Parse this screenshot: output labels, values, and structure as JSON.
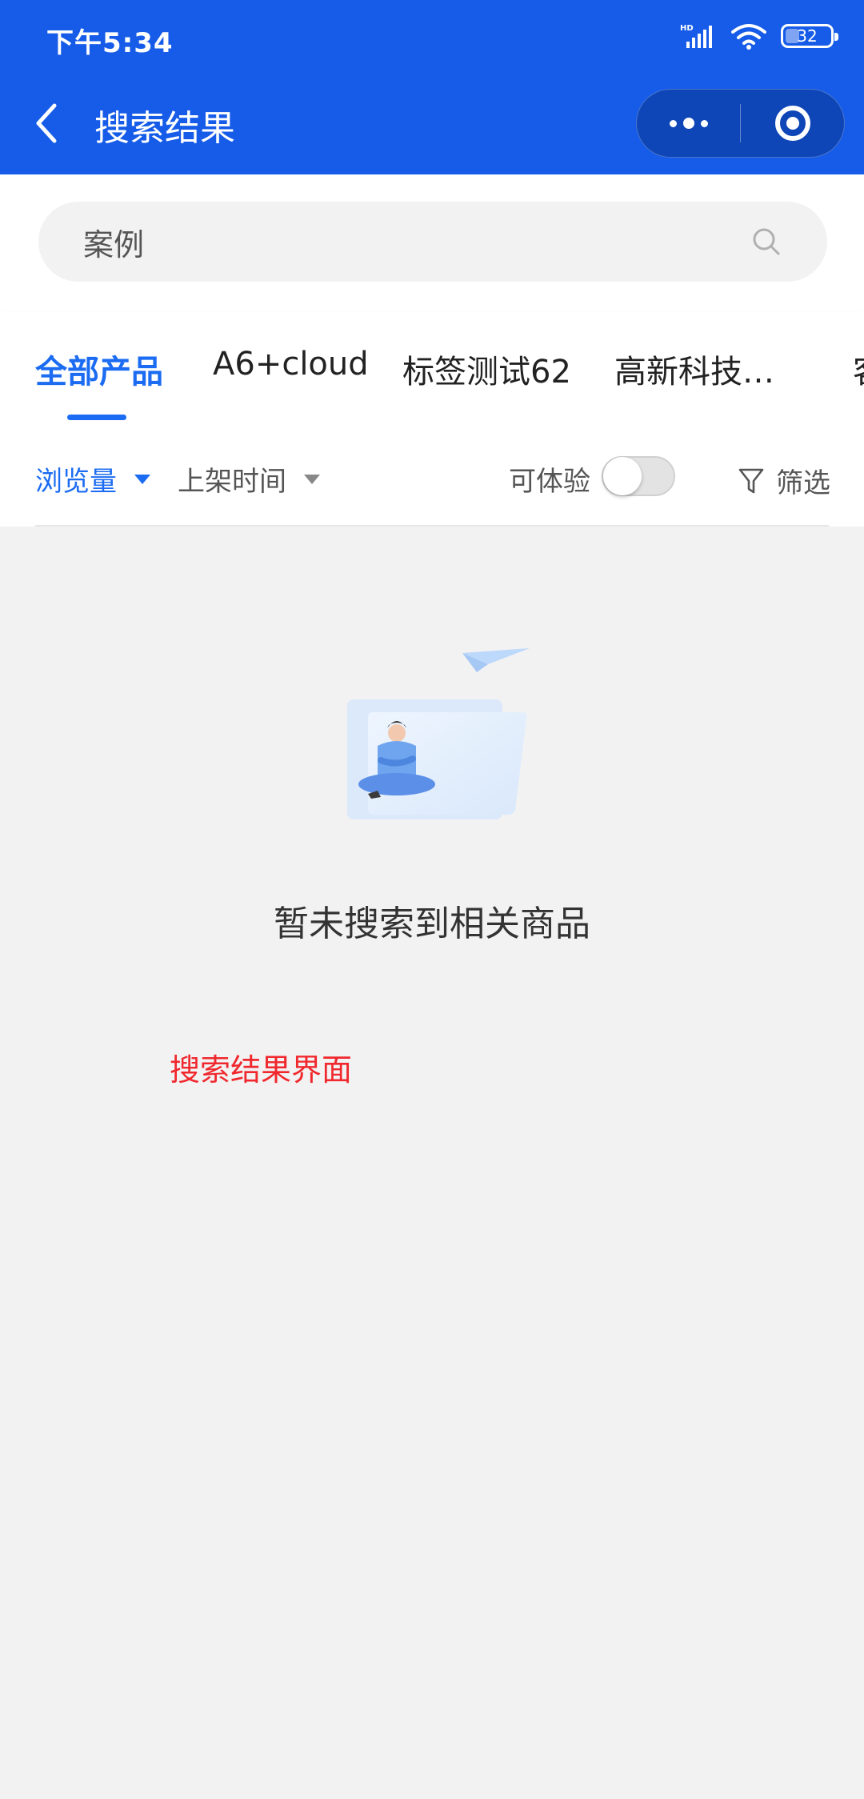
{
  "status_bar": {
    "time": "下午5:34",
    "network": "HD",
    "battery": "32"
  },
  "nav": {
    "title": "搜索结果"
  },
  "search": {
    "value": "案例"
  },
  "tabs": [
    {
      "label": "全部产品",
      "active": true
    },
    {
      "label": "A6+cloud",
      "active": false
    },
    {
      "label": "标签测试62",
      "active": false
    },
    {
      "label": "高新科技…",
      "active": false
    },
    {
      "label": "客",
      "active": false
    }
  ],
  "sort": {
    "views": "浏览量",
    "listing_time": "上架时间",
    "experience_label": "可体验",
    "experience_on": false,
    "filter": "筛选"
  },
  "empty_state": {
    "message": "暂未搜索到相关商品"
  },
  "annotation": "搜索结果界面",
  "colors": {
    "header": "#165ce8",
    "accent": "#1b6cf2",
    "annotation": "#f0282d"
  }
}
